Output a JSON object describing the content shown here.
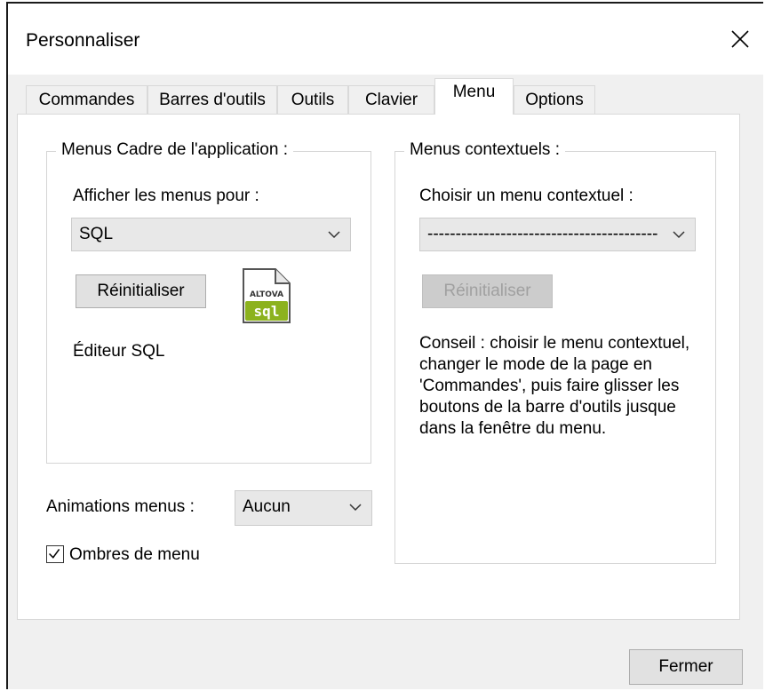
{
  "window": {
    "title": "Personnaliser"
  },
  "tabs": [
    {
      "label": "Commandes"
    },
    {
      "label": "Barres d'outils"
    },
    {
      "label": "Outils"
    },
    {
      "label": "Clavier"
    },
    {
      "label": "Menu"
    },
    {
      "label": "Options"
    }
  ],
  "active_tab": "Menu",
  "app_menus": {
    "group_title": "Menus Cadre de l'application :",
    "show_for_label": "Afficher les menus pour :",
    "selected": "SQL",
    "reset_label": "Réinitialiser",
    "icon_text_top": "ALTOVA",
    "icon_text_bottom": "sql",
    "editor_label": "Éditeur SQL"
  },
  "context_menus": {
    "group_title": "Menus contextuels :",
    "choose_label": "Choisir un menu contextuel :",
    "selected": "-----------------------------------------",
    "reset_label": "Réinitialiser",
    "tip": "Conseil : choisir le menu contextuel, changer le mode de la page en 'Commandes', puis faire glisser les boutons de la barre d'outils jusque dans la fenêtre du menu."
  },
  "animations": {
    "label": "Animations menus :",
    "selected": "Aucun"
  },
  "shadows": {
    "label": "Ombres de menu",
    "checked": true
  },
  "footer": {
    "close_label": "Fermer"
  },
  "colors": {
    "tab_border": "#d9d9d9",
    "icon_green": "#8cb21e",
    "disabled_text": "#a0a0a0"
  }
}
